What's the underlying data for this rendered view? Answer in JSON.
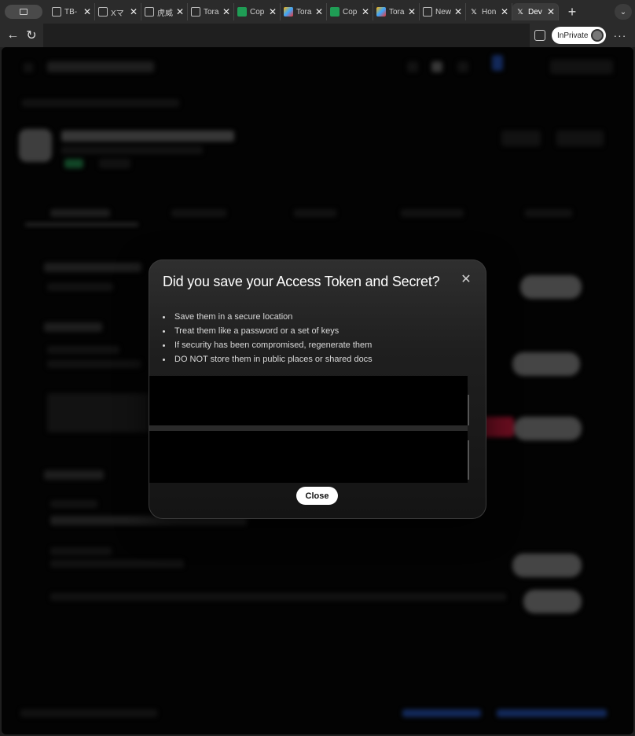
{
  "browser": {
    "tabs": [
      {
        "title": "TB-",
        "favicon": "globe-icon"
      },
      {
        "title": "Xマ",
        "favicon": "globe-icon"
      },
      {
        "title": "虎威",
        "favicon": "globe-icon"
      },
      {
        "title": "Tora",
        "favicon": "globe-icon"
      },
      {
        "title": "Cop",
        "favicon": "green-app-icon"
      },
      {
        "title": "Tora",
        "favicon": "colorful-app-icon"
      },
      {
        "title": "Cop",
        "favicon": "green-app-icon"
      },
      {
        "title": "Tora",
        "favicon": "colorful-app-icon"
      },
      {
        "title": "New",
        "favicon": "calendar-icon"
      },
      {
        "title": "Hon",
        "favicon": "x-logo-icon"
      },
      {
        "title": "Dev",
        "favicon": "x-logo-icon",
        "active": true
      }
    ],
    "tab_close_glyph": "✕",
    "new_tab_glyph": "+",
    "tab_menu_glyph": "⌄",
    "back_glyph": "←",
    "reload_glyph": "↻",
    "inprivate_label": "InPrivate",
    "more_glyph": "···"
  },
  "modal": {
    "title": "Did you save your Access Token and Secret?",
    "close_icon_glyph": "✕",
    "tips": [
      "Save them in a secure location",
      "Treat them like a password or a set of keys",
      "If security has been compromised, regenerate them",
      "DO NOT store them in public places or shared docs"
    ],
    "close_button_label": "Close"
  },
  "colors": {
    "modal_bg": "#1f1f1f",
    "page_bg": "#050505",
    "close_button_bg": "#ffffff",
    "alert_red": "#a01530"
  }
}
